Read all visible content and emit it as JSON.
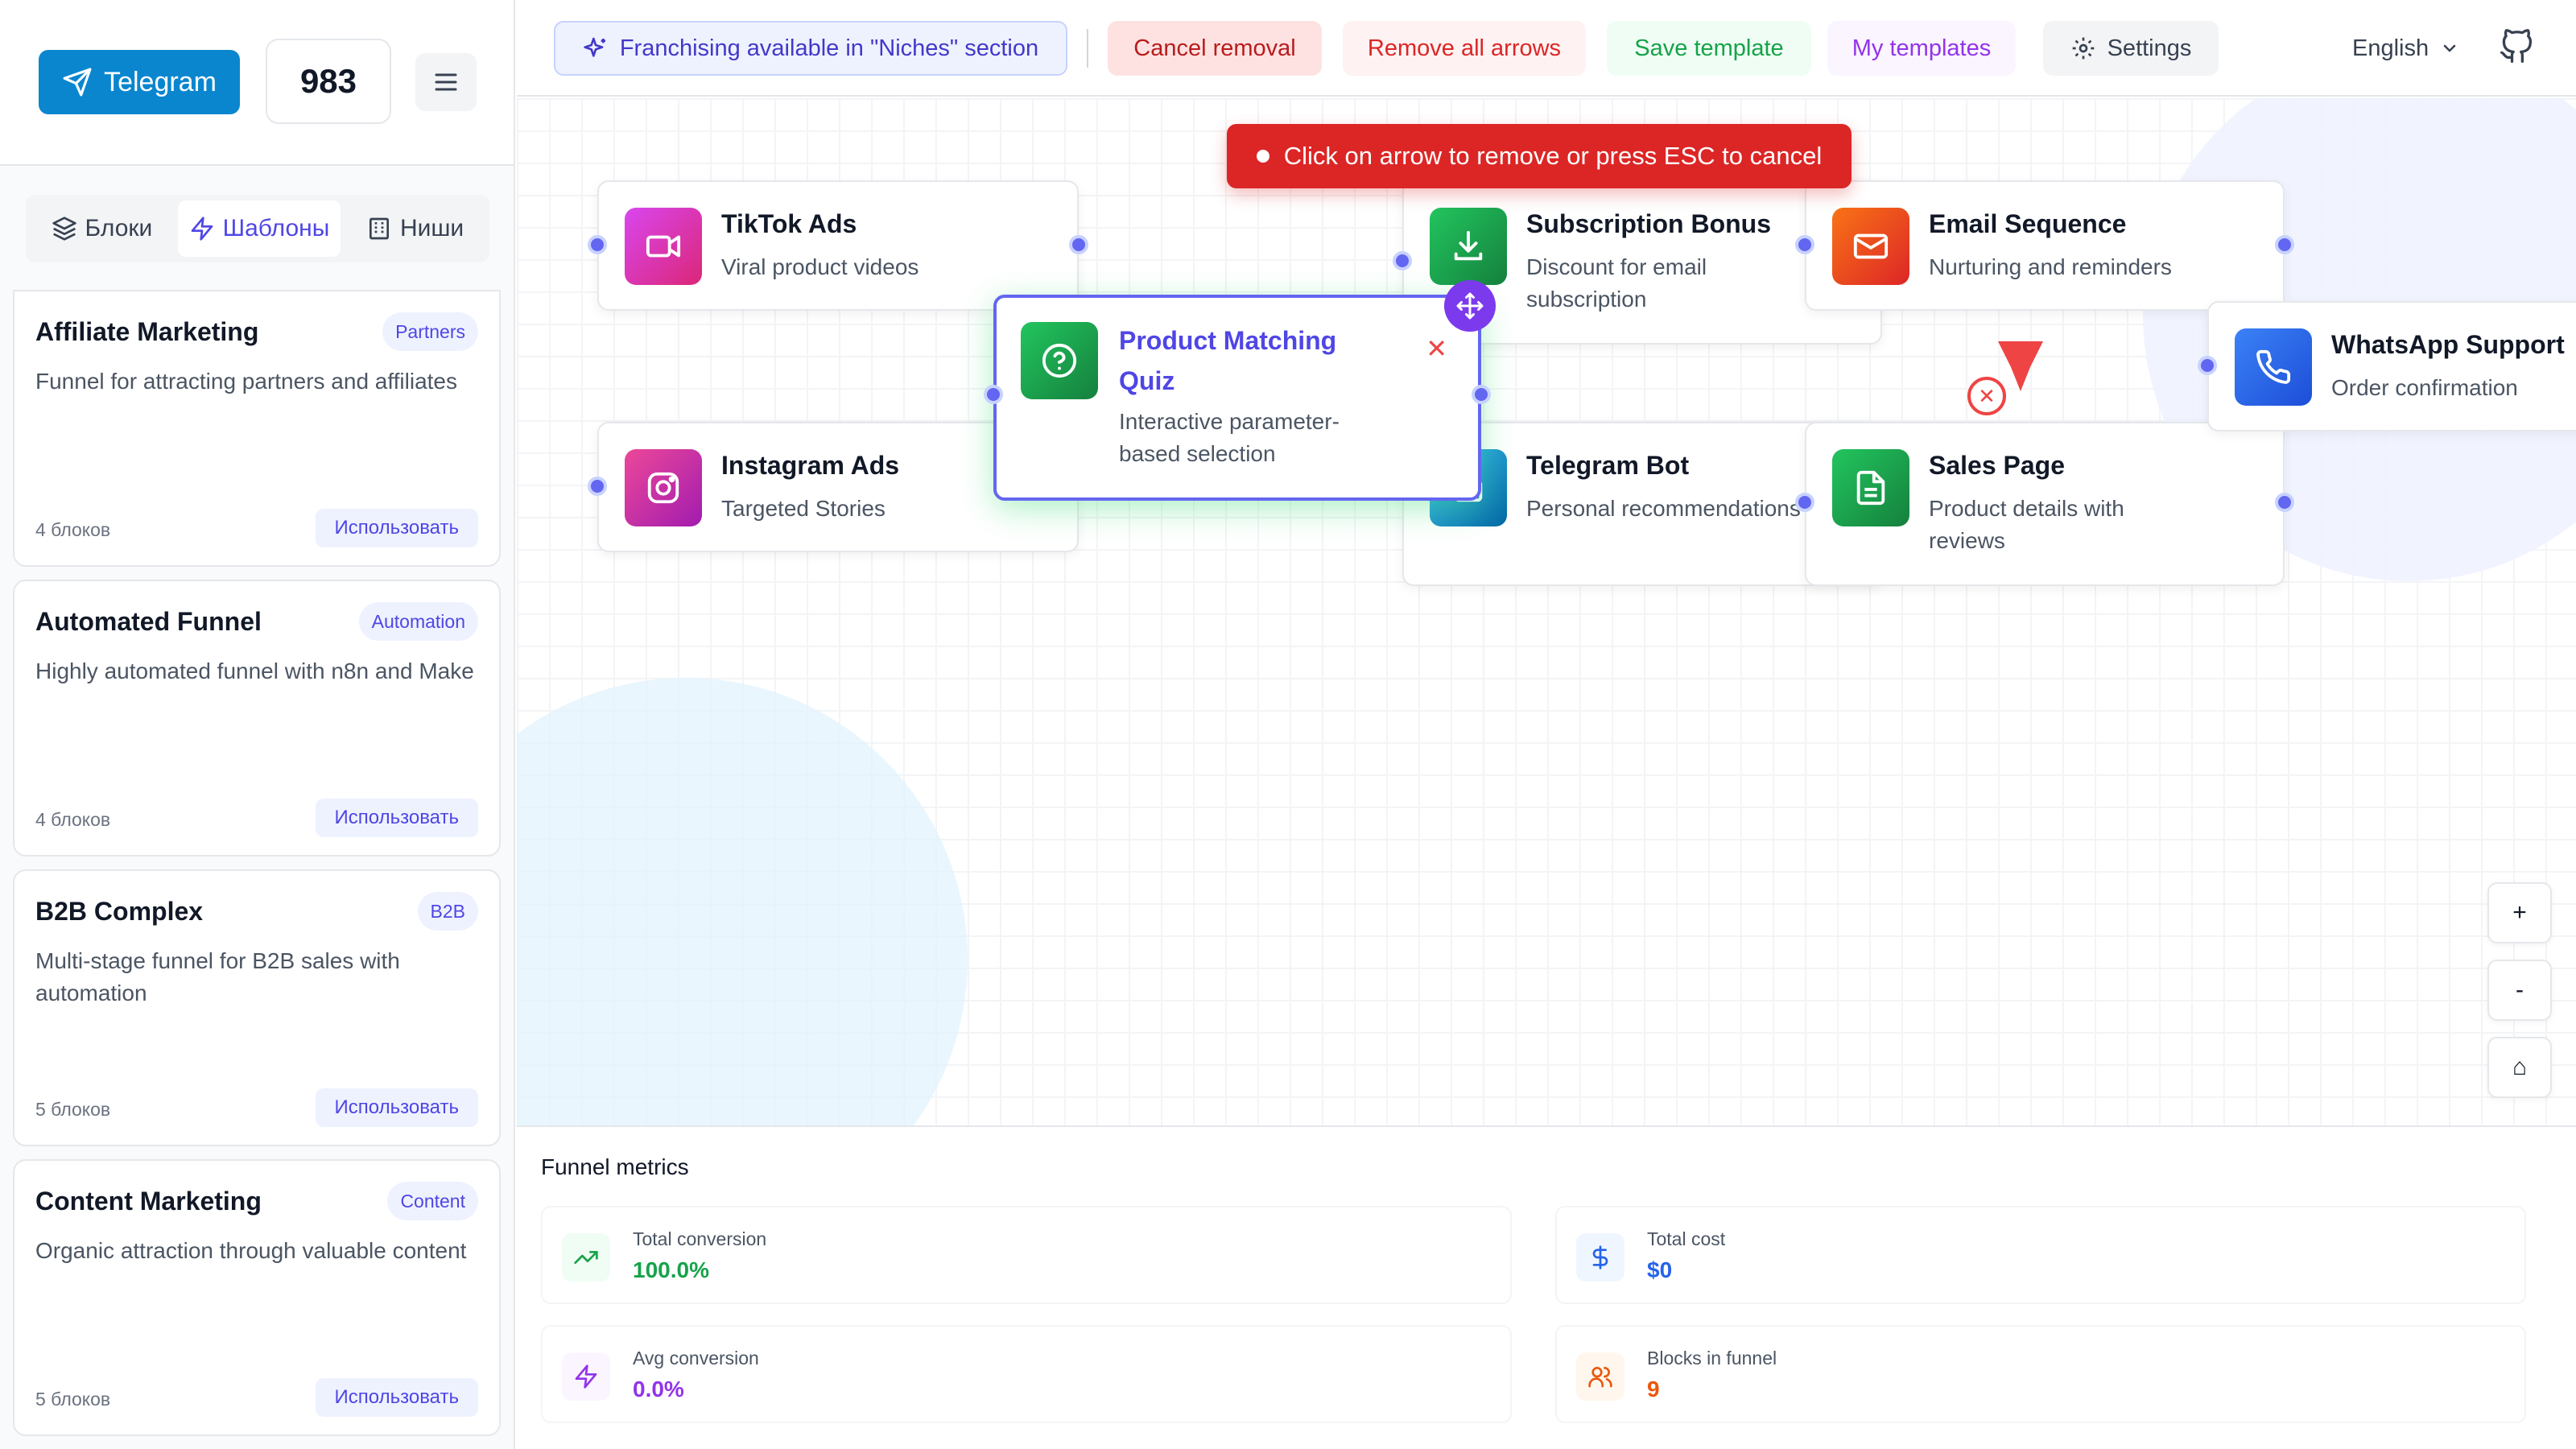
{
  "sidebar": {
    "telegram_label": "Telegram",
    "counter": "983",
    "tabs": [
      {
        "label": "Блоки"
      },
      {
        "label": "Шаблоны"
      },
      {
        "label": "Ниши"
      }
    ],
    "templates": [
      {
        "title": "Affiliate Marketing",
        "badge": "Partners",
        "desc": "Funnel for attracting partners and affiliates",
        "count": "4 блоков",
        "use": "Использовать"
      },
      {
        "title": "Automated Funnel",
        "badge": "Automation",
        "desc": "Highly automated funnel with n8n and Make",
        "count": "4 блоков",
        "use": "Использовать"
      },
      {
        "title": "B2B Complex",
        "badge": "B2B",
        "desc": "Multi-stage funnel for B2B sales with automation",
        "count": "5 блоков",
        "use": "Использовать"
      },
      {
        "title": "Content Marketing",
        "badge": "Content",
        "desc": "Organic attraction through valuable content",
        "count": "5 блоков",
        "use": "Использовать"
      }
    ]
  },
  "toolbar": {
    "franchising": "Franchising available in \"Niches\" section",
    "cancel_removal": "Cancel removal",
    "remove_all_arrows": "Remove all arrows",
    "save_template": "Save template",
    "my_templates": "My templates",
    "settings": "Settings",
    "language": "English"
  },
  "canvas": {
    "toast": "Click on arrow to remove or press ESC to cancel",
    "nodes": {
      "tiktok": {
        "title": "TikTok Ads",
        "sub": "Viral product videos"
      },
      "instagram": {
        "title": "Instagram Ads",
        "sub": "Targeted Stories"
      },
      "quiz": {
        "title": "Product Matching Quiz",
        "sub": "Interactive parameter-based selection"
      },
      "subscription": {
        "title": "Subscription Bonus",
        "sub": "Discount for email subscription"
      },
      "telegram_bot": {
        "title": "Telegram Bot",
        "sub": "Personal recommendations"
      },
      "email": {
        "title": "Email Sequence",
        "sub": "Nurturing and reminders"
      },
      "sales": {
        "title": "Sales Page",
        "sub": "Product details with reviews"
      },
      "whatsapp": {
        "title": "WhatsApp Support",
        "sub": "Order confirmation"
      }
    },
    "zoom_in": "+",
    "zoom_out": "-",
    "home": "⌂"
  },
  "metrics": {
    "title": "Funnel metrics",
    "total_conversion": {
      "label": "Total conversion",
      "value": "100.0%"
    },
    "total_cost": {
      "label": "Total cost",
      "value": "$0"
    },
    "avg_conversion": {
      "label": "Avg conversion",
      "value": "0.0%"
    },
    "blocks": {
      "label": "Blocks in funnel",
      "value": "9"
    }
  },
  "colors": {
    "accent": "#6366f1",
    "telegram": "#0a86cf",
    "danger": "#dc2626",
    "success": "#16a34a"
  }
}
